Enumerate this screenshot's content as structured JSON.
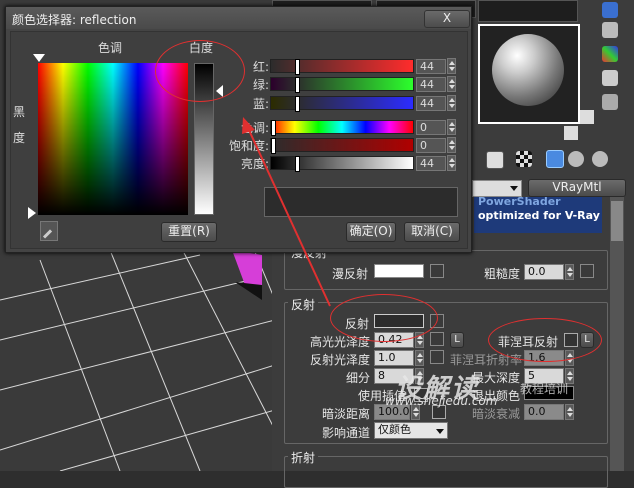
{
  "dialog": {
    "title": "颜色选择器: reflection",
    "close_label": "X",
    "hue_label": "色调",
    "whiteness_label": "白度",
    "blackness_label_1": "黑",
    "blackness_label_2": "度",
    "reset_button": "重置(R)",
    "ok_button": "确定(O)",
    "cancel_button": "取消(C)",
    "channels": [
      {
        "label": "红:",
        "value": "44"
      },
      {
        "label": "绿:",
        "value": "44"
      },
      {
        "label": "蓝:",
        "value": "44"
      },
      {
        "label": "色调:",
        "value": "0"
      },
      {
        "label": "饱和度:",
        "value": "0"
      },
      {
        "label": "亮度:",
        "value": "44"
      }
    ]
  },
  "material": {
    "type_button": "VRayMtl",
    "banner_text": "optimized for V-Ray",
    "banner_top": "PowerShader",
    "diffuse_group": "漫反射",
    "diffuse_label": "漫反射",
    "roughness_label": "粗糙度",
    "roughness_value": "0.0",
    "reflection_group": "反射",
    "reflect_label": "反射",
    "hilight_gloss_label": "高光光泽度",
    "hilight_gloss_value": "0.42",
    "l_button": "L",
    "fresnel_label": "菲涅耳反射",
    "refl_gloss_label": "反射光泽度",
    "refl_gloss_value": "1.0",
    "fresnel_ior_label": "菲涅耳折射率",
    "fresnel_ior_value": "1.6",
    "subdivs_label": "细分",
    "subdivs_value": "8",
    "max_depth_label": "最大深度",
    "max_depth_value": "5",
    "use_interp_label": "使用插值",
    "exit_color_label": "退出颜色",
    "dim_distance_label": "暗淡距离",
    "dim_distance_value": "100.0",
    "dim_falloff_label": "暗淡衰减",
    "dim_falloff_value": "0.0",
    "affect_channels_label": "影响通道",
    "affect_channels_value": "仅颜色",
    "refraction_group": "折射"
  },
  "watermark": {
    "line1": "设解读",
    "line2": "www.shejiedu.com",
    "line3": "教程培训"
  },
  "colors": {
    "accent_red": "#e03030",
    "reflect_swatch": "#2c2c2c",
    "diffuse_swatch": "#ffffff"
  }
}
